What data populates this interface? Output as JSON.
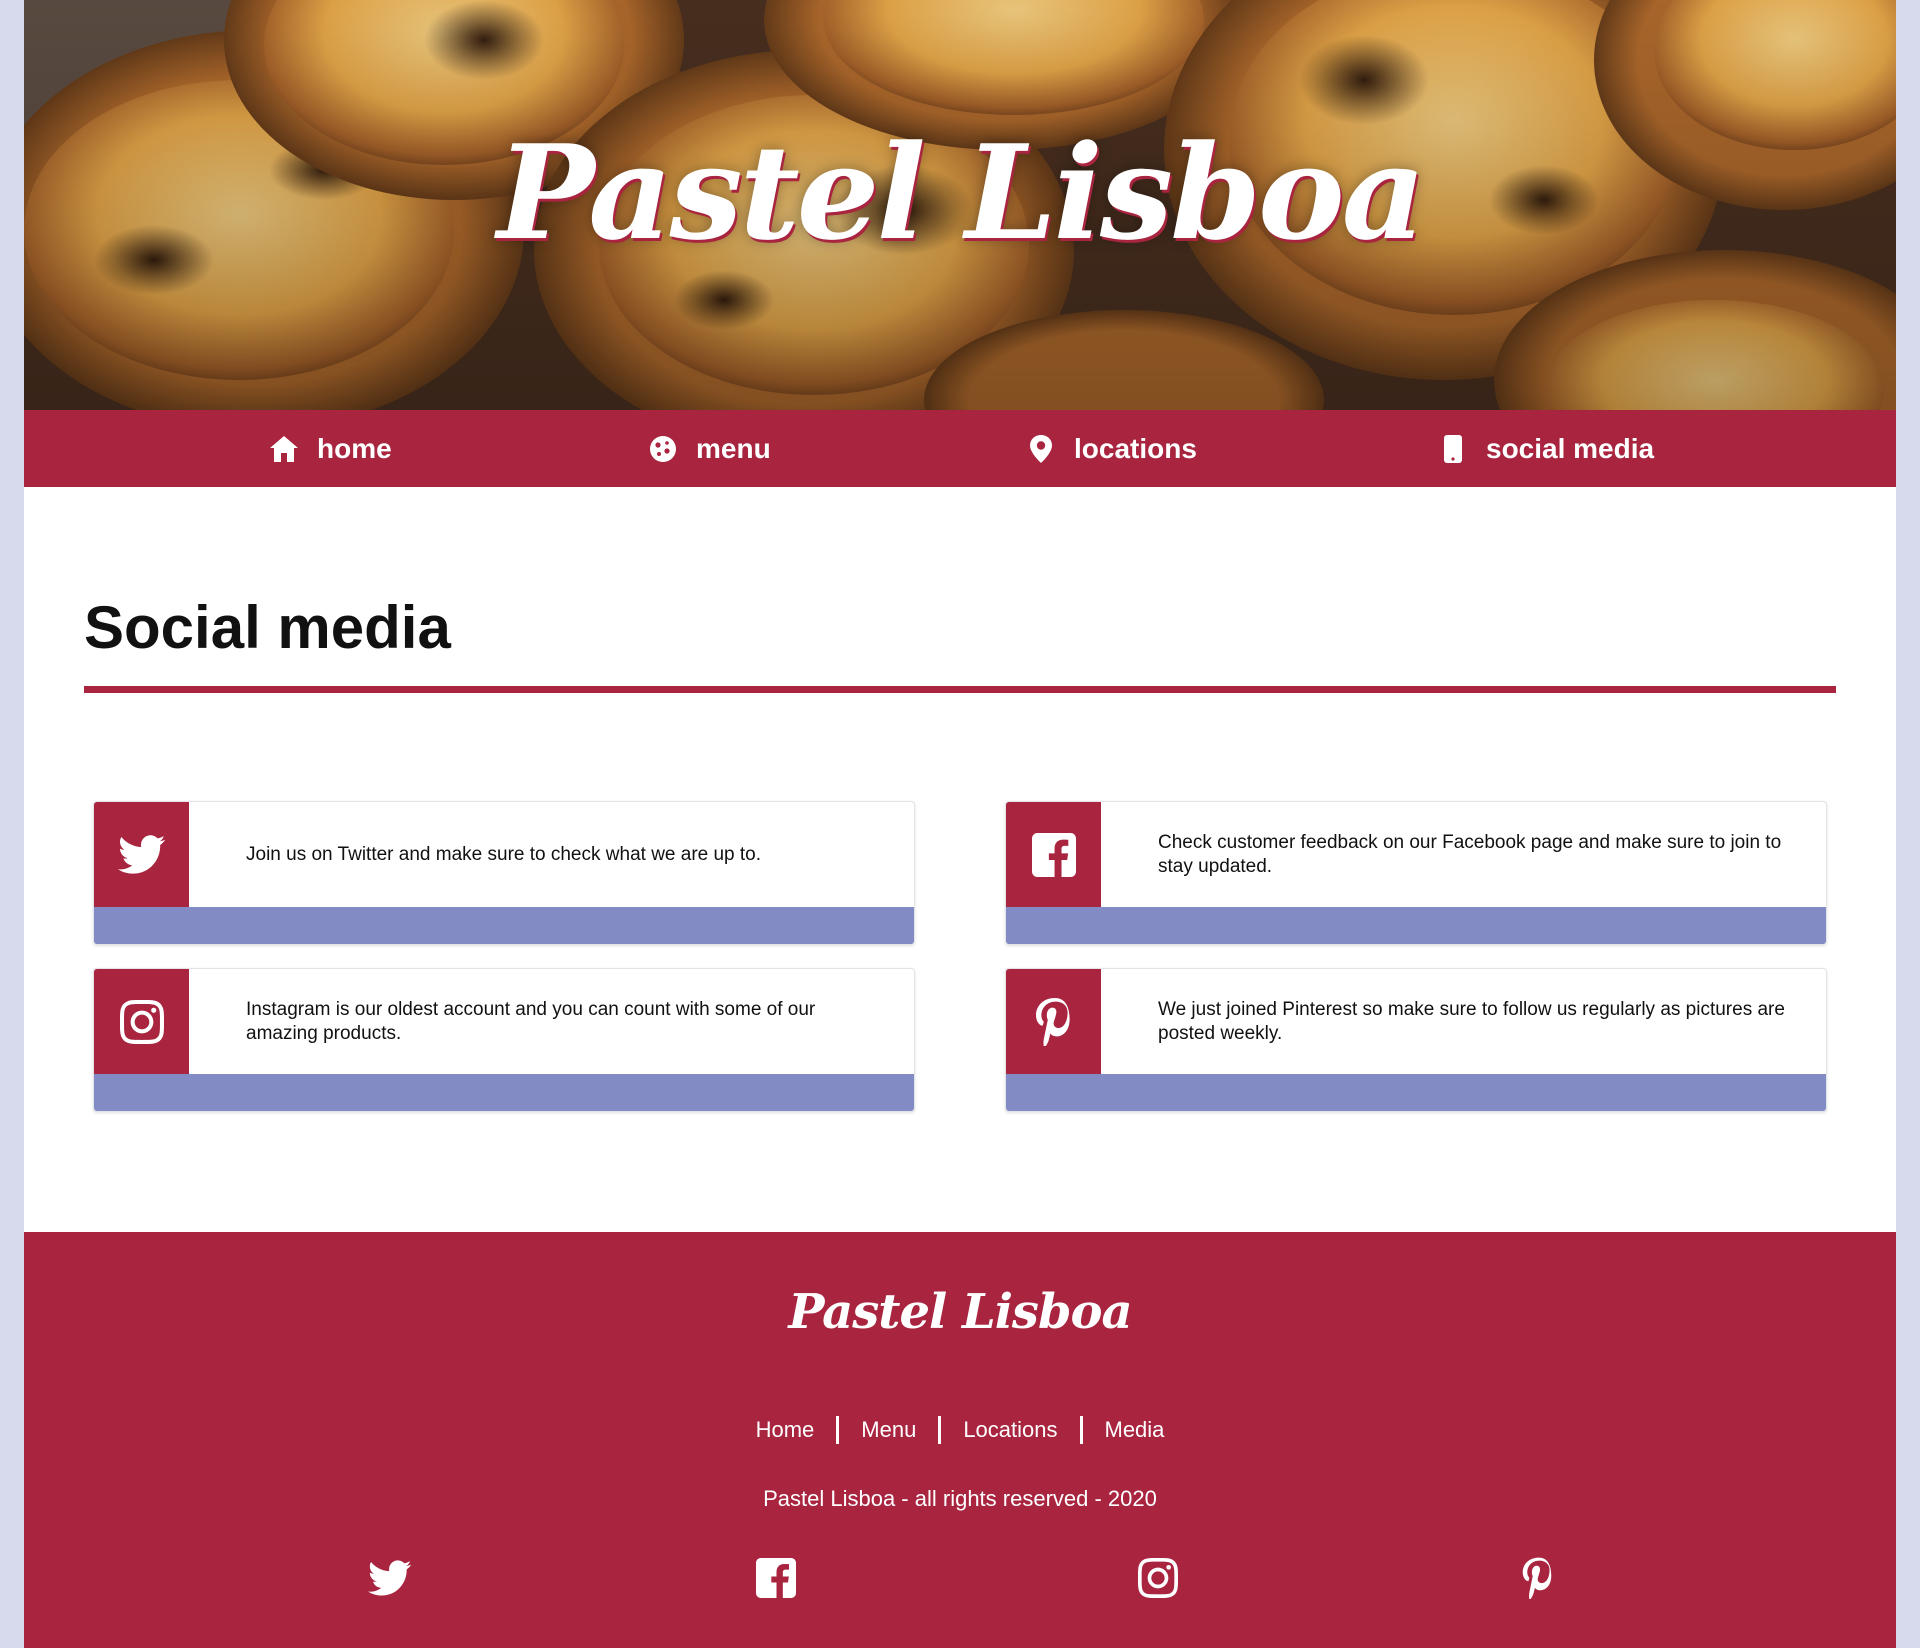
{
  "site": {
    "brand": "Pastel Lisboa"
  },
  "nav": {
    "items": [
      {
        "label": "home",
        "icon": "home-icon"
      },
      {
        "label": "menu",
        "icon": "cookie-icon"
      },
      {
        "label": "locations",
        "icon": "map-pin-icon"
      },
      {
        "label": "social media",
        "icon": "mobile-phone-icon"
      }
    ]
  },
  "main": {
    "title": "Social media",
    "cards": [
      {
        "network": "twitter",
        "icon": "twitter-icon",
        "text": "Join us on Twitter and make sure to check what we are up to."
      },
      {
        "network": "facebook",
        "icon": "facebook-icon",
        "text": "Check customer feedback on our Facebook page and make sure to join to stay updated."
      },
      {
        "network": "instagram",
        "icon": "instagram-icon",
        "text": "Instagram is our oldest account and you can count with some of our amazing products."
      },
      {
        "network": "pinterest",
        "icon": "pinterest-icon",
        "text": "We just joined Pinterest so make sure to follow us regularly as pictures are posted weekly."
      }
    ]
  },
  "footer": {
    "brand": "Pastel Lisboa",
    "links": [
      "Home",
      "Menu",
      "Locations",
      "Media"
    ],
    "copyright": "Pastel Lisboa - all rights reserved - 2020",
    "social_icons": [
      "twitter-icon",
      "facebook-icon",
      "instagram-icon",
      "pinterest-icon"
    ]
  },
  "colors": {
    "brand_red": "#a8243f",
    "card_bar": "#838bc4",
    "page_bg": "#d7d9ec"
  }
}
